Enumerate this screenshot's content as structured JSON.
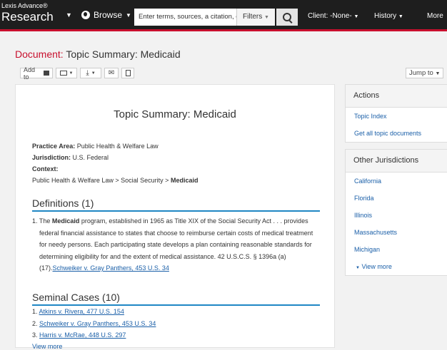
{
  "header": {
    "logo_small": "Lexis Advance®",
    "logo_big": "Research",
    "browse_label": "Browse",
    "search_placeholder": "Enter terms, sources, a citation, o",
    "filters_label": "Filters",
    "client_label": "Client: -None-",
    "history_label": "History",
    "more_label": "More"
  },
  "page": {
    "title_prefix": "Document:",
    "title": "Topic Summary: Medicaid"
  },
  "toolbar": {
    "add_to_label": "Add to",
    "jump_to_label": "Jump to"
  },
  "document": {
    "heading": "Topic Summary: Medicaid",
    "practice_area_label": "Practice Area:",
    "practice_area_value": "Public Health & Welfare Law",
    "jurisdiction_label": "Jurisdiction:",
    "jurisdiction_value": "U.S. Federal",
    "context_label": "Context:",
    "context_path": "Public Health & Welfare Law > Social Security >",
    "context_topic": "Medicaid",
    "definitions_title": "Definitions (1)",
    "def_number": "1. The",
    "def_term": "Medicaid",
    "def_line1_rest": "program, established in 1965 as Title XIX of the Social Security Act . . . provides",
    "def_line2": "federal financial assistance to states that choose to reimburse certain costs of medical treatment",
    "def_line3": "for needy persons. Each participating state develops a plan containing reasonable standards for",
    "def_line4": "determining eligibility for and the extent of medical assistance. 42 U.S.C.S. § 1396a (a)",
    "def_line5_prefix": "(17).",
    "def_citation": "Schweiker v. Gray Panthers, 453 U.S. 34",
    "seminal_title": "Seminal Cases (10)",
    "cases": [
      {
        "num": "1.",
        "name": "Atkins v. Rivera, 477 U.S. 154"
      },
      {
        "num": "2.",
        "name": "Schweiker v. Gray Panthers, 453 U.S. 34"
      },
      {
        "num": "3.",
        "name": "Harris v. McRae, 448 U.S. 297"
      }
    ],
    "view_more": "View more"
  },
  "actions": {
    "title": "Actions",
    "items": [
      "Topic Index",
      "Get all topic documents"
    ]
  },
  "other_jurisdictions": {
    "title": "Other Jurisdictions",
    "items": [
      "California",
      "Florida",
      "Illinois",
      "Massachusetts",
      "Michigan"
    ],
    "view_more": "View more"
  },
  "colors": {
    "accent_red": "#c8102e",
    "link_blue": "#1a5fa8",
    "rule_blue": "#1f87c4",
    "topbar": "#1e1e1e"
  }
}
